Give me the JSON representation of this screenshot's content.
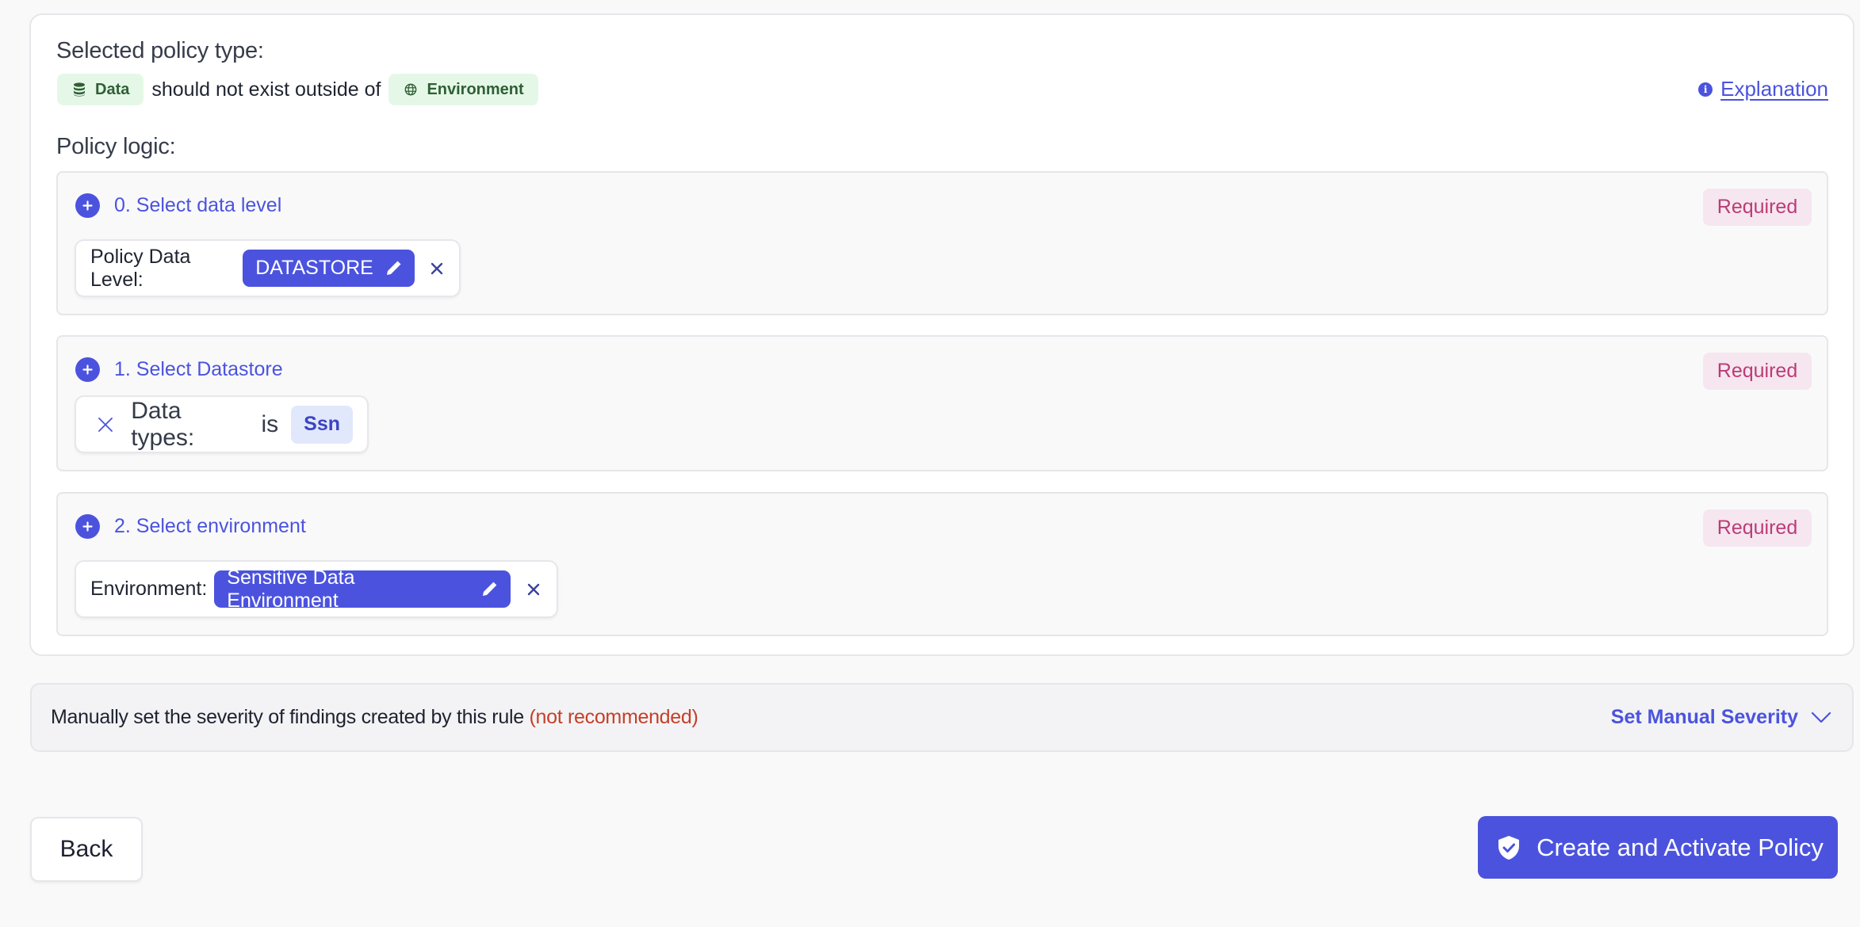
{
  "policy_type": {
    "heading": "Selected policy type:",
    "subject_pill": {
      "icon": "database-icon",
      "label": "Data"
    },
    "connector_text": "should not exist outside of",
    "object_pill": {
      "icon": "globe-icon",
      "label": "Environment"
    },
    "explanation_link": "Explanation"
  },
  "policy_logic": {
    "heading": "Policy logic:",
    "sections": [
      {
        "title": "0. Select data level",
        "badge": "Required",
        "field_label": "Policy Data Level:",
        "value": "DATASTORE"
      },
      {
        "title": "1. Select Datastore",
        "badge": "Required",
        "field_label": "Data types:",
        "operator": "is",
        "value": "Ssn"
      },
      {
        "title": "2. Select environment",
        "badge": "Required",
        "field_label": "Environment:",
        "value": "Sensitive Data Environment"
      }
    ]
  },
  "severity": {
    "text": "Manually set the severity of findings created by this rule",
    "warning": "(not recommended)",
    "toggle_label": "Set Manual Severity"
  },
  "footer": {
    "back_label": "Back",
    "create_label": "Create and Activate Policy"
  },
  "colors": {
    "accent": "#4b53de",
    "required_text": "#bb3c76",
    "required_bg": "#f6e6f0",
    "pill_green_bg": "#e5f8e7",
    "pill_green_text": "#2f5f35",
    "warning": "#c4402a"
  }
}
